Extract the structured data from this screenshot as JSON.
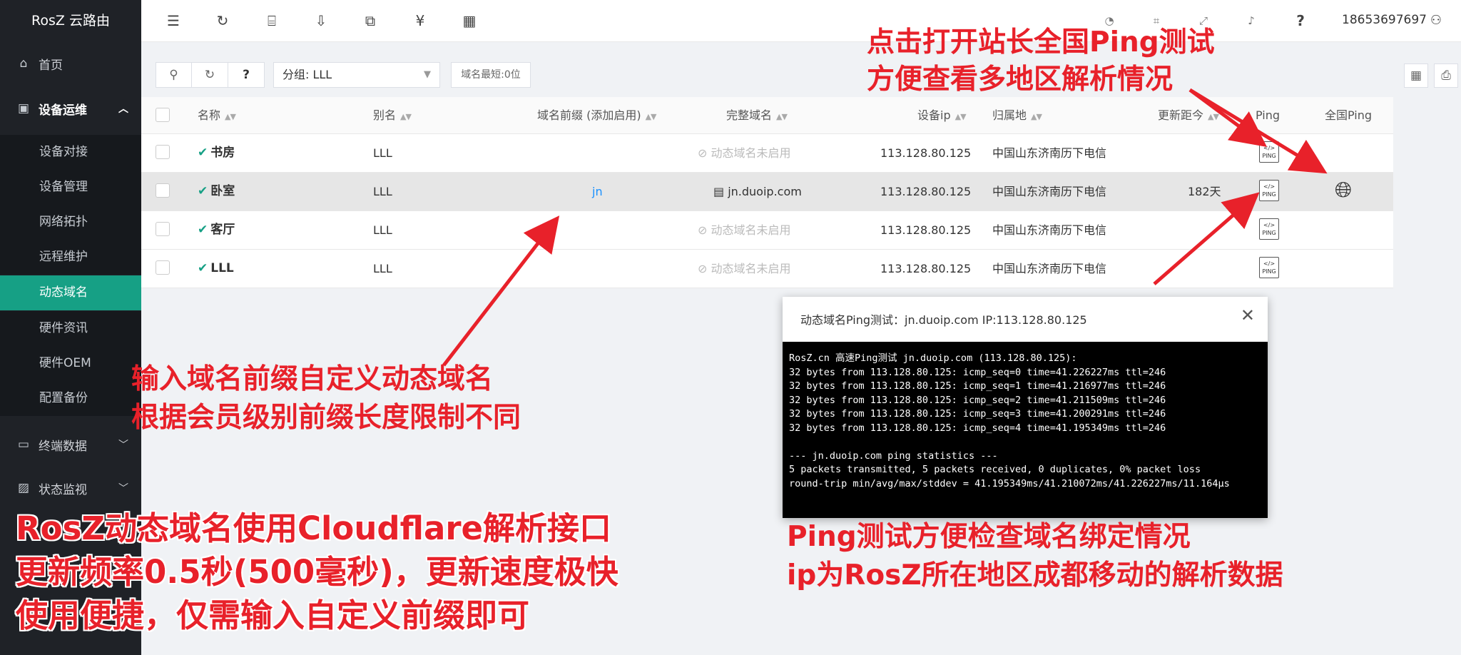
{
  "app": {
    "title": "RosZ 云路由"
  },
  "sidebar": {
    "items": [
      {
        "label": "首页",
        "icon": "home-icon"
      },
      {
        "label": "设备运维",
        "icon": "device-icon"
      }
    ],
    "sub_items": [
      "设备对接",
      "设备管理",
      "网络拓扑",
      "远程维护",
      "动态域名",
      "硬件资讯",
      "硬件OEM",
      "配置备份"
    ],
    "collapsed": [
      {
        "label": "终端数据",
        "icon": "monitor-icon"
      },
      {
        "label": "状态监视",
        "icon": "image-icon"
      }
    ]
  },
  "topbar": {
    "user": "18653697697"
  },
  "toolbar": {
    "help_label": "?",
    "group_value": "分组: LLL",
    "min_len_label": "域名最短:0位"
  },
  "table": {
    "headers": {
      "name": "名称",
      "alias": "别名",
      "prefix": "域名前缀 (添加启用)",
      "full": "完整域名",
      "ip": "设备ip",
      "location": "归属地",
      "updated": "更新距今",
      "ping": "Ping",
      "global_ping": "全国Ping"
    },
    "rows": [
      {
        "name": "书房",
        "alias": "LLL",
        "prefix": "",
        "full": "动态域名未启用",
        "ip": "113.128.80.125",
        "location": "中国山东济南历下电信",
        "updated": ""
      },
      {
        "name": "卧室",
        "alias": "LLL",
        "prefix": "jn",
        "full": "jn.duoip.com",
        "ip": "113.128.80.125",
        "location": "中国山东济南历下电信",
        "updated": "182天"
      },
      {
        "name": "客厅",
        "alias": "LLL",
        "prefix": "",
        "full": "动态域名未启用",
        "ip": "113.128.80.125",
        "location": "中国山东济南历下电信",
        "updated": ""
      },
      {
        "name": "LLL",
        "alias": "LLL",
        "prefix": "",
        "full": "动态域名未启用",
        "ip": "113.128.80.125",
        "location": "中国山东济南历下电信",
        "updated": ""
      }
    ],
    "ping_label": "PING"
  },
  "dialog": {
    "title": "动态域名Ping测试：jn.duoip.com IP:113.128.80.125",
    "close": "✕",
    "output": "RosZ.cn 高速Ping测试 jn.duoip.com (113.128.80.125):\n32 bytes from 113.128.80.125: icmp_seq=0 time=41.226227ms ttl=246\n32 bytes from 113.128.80.125: icmp_seq=1 time=41.216977ms ttl=246\n32 bytes from 113.128.80.125: icmp_seq=2 time=41.211509ms ttl=246\n32 bytes from 113.128.80.125: icmp_seq=3 time=41.200291ms ttl=246\n32 bytes from 113.128.80.125: icmp_seq=4 time=41.195349ms ttl=246\n\n--- jn.duoip.com ping statistics ---\n5 packets transmitted, 5 packets received, 0 duplicates, 0% packet loss\nround-trip min/avg/max/stddev = 41.195349ms/41.210072ms/41.226227ms/11.164µs"
  },
  "annotations": {
    "top_right": [
      "点击打开站长全国Ping测试",
      "方便查看多地区解析情况"
    ],
    "middle_left": [
      "输入域名前缀自定义动态域名",
      "根据会员级别前缀长度限制不同"
    ],
    "bottom_left": [
      "RosZ动态域名使用Cloudflare解析接口",
      "更新频率0.5秒(500毫秒)，更新速度极快",
      "使用便捷，仅需输入自定义前缀即可"
    ],
    "bottom_right": [
      "Ping测试方便检查域名绑定情况",
      "ip为RosZ所在地区成都移动的解析数据"
    ]
  },
  "colors": {
    "accent": "#16a085",
    "annotation": "#e8212a",
    "sidebar": "#1f2227"
  }
}
